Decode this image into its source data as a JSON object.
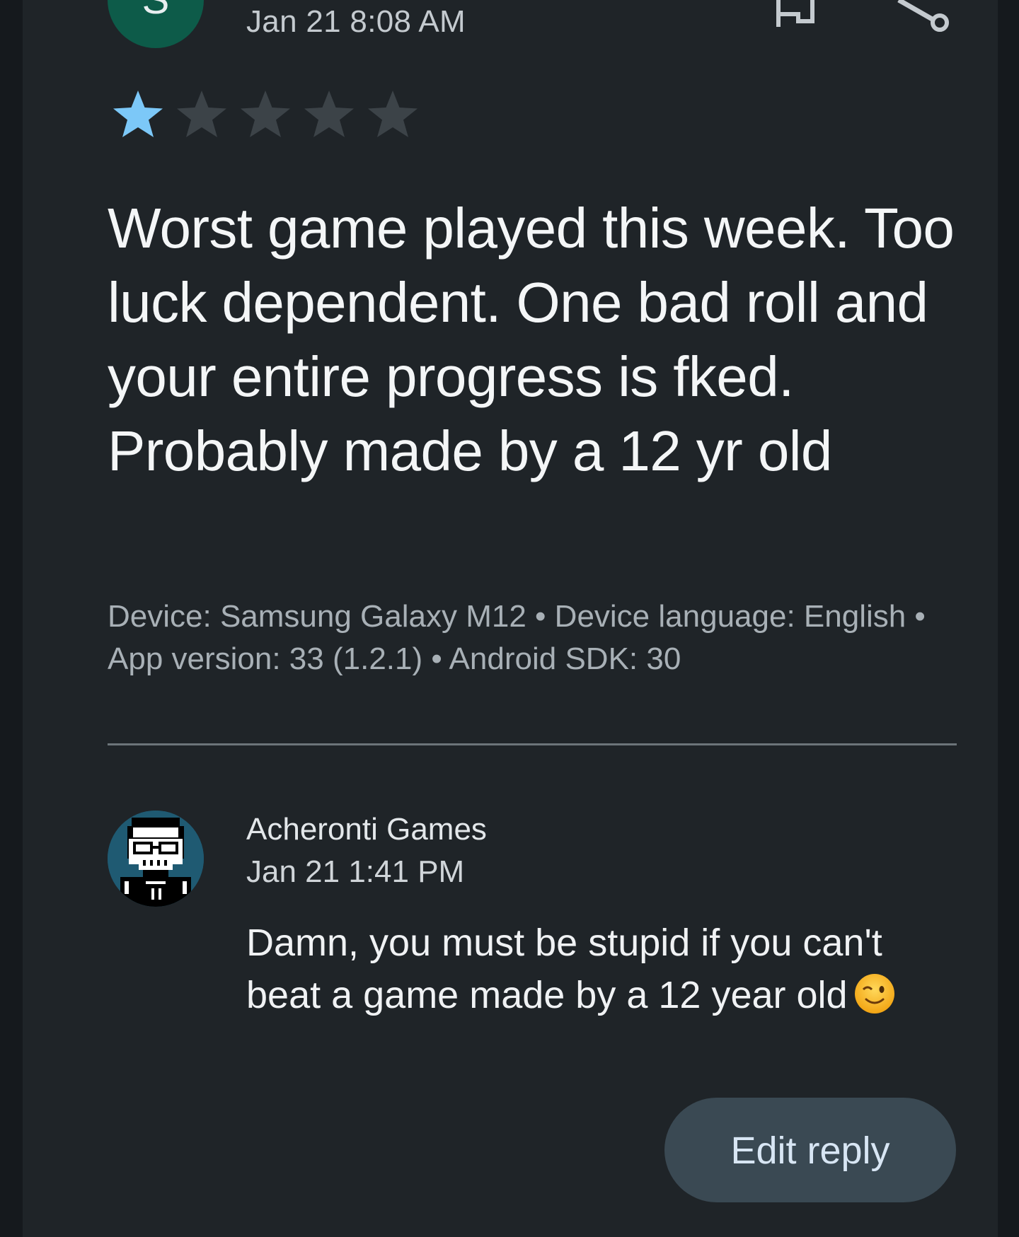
{
  "review": {
    "avatar_initial": "S",
    "date": "Jan 21 8:08 AM",
    "rating": 1,
    "rating_max": 5,
    "text": "Worst game played this week. Too luck dependent. One bad roll and your entire progress is fked. Probably made by a 12 yr old",
    "device_info": "Device: Samsung Galaxy M12 • Device language: English • App version: 33 (1.2.1) • Android SDK: 30",
    "icons": [
      "flag-icon",
      "share-icon"
    ]
  },
  "reply": {
    "developer_name": "Acheronti Games",
    "date": "Jan 21 1:41 PM",
    "text": "Damn, you must be stupid if you can't beat a game made by a 12 year old",
    "emoji_icon": "winking-face-emoji"
  },
  "actions": {
    "edit_reply_label": "Edit reply"
  },
  "colors": {
    "star_filled": "#7cc8f8",
    "star_empty": "#3c4348",
    "avatar_reviewer_bg": "#0d5b49",
    "button_bg": "#3a4953"
  }
}
